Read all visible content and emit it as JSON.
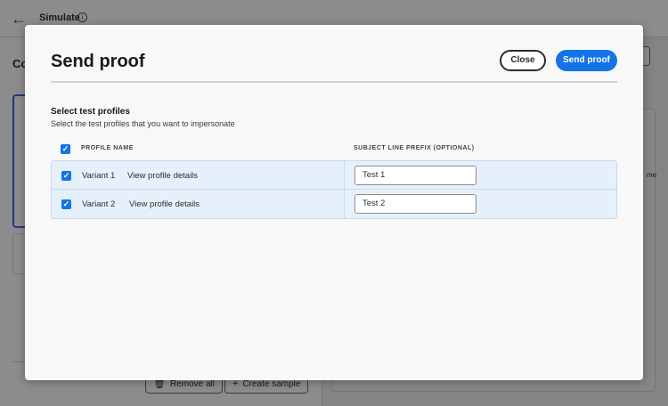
{
  "background": {
    "title": "Simulate",
    "left_title_partial": "Co",
    "buttons": {
      "remove_all": "Remove all",
      "create_sample": "Create sample"
    },
    "cut_text": "me"
  },
  "modal": {
    "title": "Send proof",
    "close_label": "Close",
    "send_label": "Send proof",
    "section_title": "Select test profiles",
    "section_desc": "Select the test profiles that you want to impersonate",
    "columns": {
      "profile_name": "PROFILE NAME",
      "subject_prefix": "SUBJECT LINE PREFIX (OPTIONAL)"
    },
    "rows": [
      {
        "name": "Variant 1",
        "link": "View profile details",
        "prefix": "Test 1",
        "checked": true
      },
      {
        "name": "Variant 2",
        "link": "View profile details",
        "prefix": "Test 2",
        "checked": true
      }
    ]
  },
  "colors": {
    "accent": "#1473e6",
    "row_bg": "#e6f0fb"
  }
}
